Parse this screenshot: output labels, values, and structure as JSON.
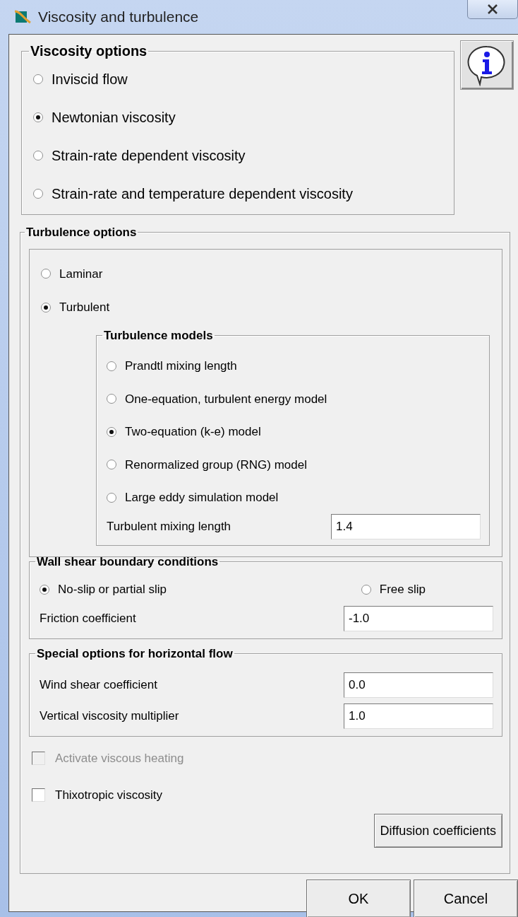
{
  "window": {
    "title": "Viscosity and turbulence"
  },
  "viscosity_options": {
    "title": "Viscosity options",
    "options": [
      {
        "label": "Inviscid flow",
        "selected": false
      },
      {
        "label": "Newtonian viscosity",
        "selected": true
      },
      {
        "label": "Strain-rate dependent viscosity",
        "selected": false
      },
      {
        "label": "Strain-rate and temperature dependent viscosity",
        "selected": false
      }
    ]
  },
  "turbulence_options": {
    "title": "Turbulence options",
    "modes": [
      {
        "label": "Laminar",
        "selected": false
      },
      {
        "label": "Turbulent",
        "selected": true
      }
    ],
    "models": {
      "title": "Turbulence models",
      "options": [
        {
          "label": "Prandtl mixing length",
          "selected": false
        },
        {
          "label": "One-equation, turbulent energy model",
          "selected": false
        },
        {
          "label": "Two-equation (k-e) model",
          "selected": true
        },
        {
          "label": "Renormalized group (RNG) model",
          "selected": false
        },
        {
          "label": "Large eddy simulation model",
          "selected": false
        }
      ],
      "mixing_length": {
        "label": "Turbulent mixing length",
        "value": "1.4"
      }
    },
    "wall_shear": {
      "title": "Wall shear boundary conditions",
      "options": [
        {
          "label": "No-slip or partial slip",
          "selected": true
        },
        {
          "label": "Free slip",
          "selected": false
        }
      ],
      "friction": {
        "label": "Friction coefficient",
        "value": "-1.0"
      }
    },
    "horizontal_flow": {
      "title": "Special options for horizontal flow",
      "fields": [
        {
          "label": "Wind shear coefficient",
          "value": "0.0"
        },
        {
          "label": "Vertical viscosity multiplier",
          "value": "1.0"
        }
      ]
    },
    "checkboxes": [
      {
        "label": "Activate viscous heating",
        "checked": false,
        "disabled": true
      },
      {
        "label": "Thixotropic viscosity",
        "checked": false,
        "disabled": false
      }
    ],
    "diffusion_button": "Diffusion coefficients"
  },
  "buttons": [
    "OK",
    "Cancel"
  ]
}
